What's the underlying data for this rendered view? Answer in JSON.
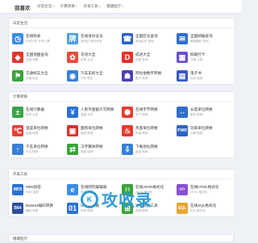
{
  "header": {
    "brand": "我喜欢",
    "nav": [
      {
        "label": "日常生活"
      },
      {
        "label": "计算转换"
      },
      {
        "label": "开发工具"
      },
      {
        "label": "健康医疗"
      }
    ]
  },
  "sections": [
    {
      "title": "日常生活",
      "tools": [
        {
          "name": "在线秒表",
          "desc": "在线计时 计时工具",
          "icon": "stopwatch-icon",
          "glyph": "◷",
          "color": "#3a8ee6"
        },
        {
          "name": "在线身份证号",
          "desc": "身份证 号码查询",
          "icon": "id-icon",
          "glyph": "牌",
          "color": "#4a9fe0"
        },
        {
          "name": "全国区号查询",
          "desc": "电话区号 查询",
          "icon": "phone-icon",
          "glyph": "☎",
          "color": "#2d62c6"
        },
        {
          "name": "全国邮编查询",
          "desc": "邮政编码 查询",
          "icon": "mail-icon",
          "glyph": "✉",
          "color": "#2f6fcc"
        },
        {
          "name": "全国地图查询",
          "desc": "全国 地图",
          "icon": "map-icon",
          "glyph": "◆",
          "color": "#e0382e"
        },
        {
          "name": "花语大全",
          "desc": "花语 大全",
          "icon": "flower-icon",
          "glyph": "✿",
          "color": "#e94b3c"
        },
        {
          "name": "成语大全",
          "desc": "成语 查询",
          "icon": "book-icon",
          "glyph": "D",
          "color": "#e8322c"
        },
        {
          "name": "假期打卡",
          "desc": "日期 计算",
          "icon": "calendar-icon",
          "glyph": "▦",
          "color": "#6c4fd2"
        },
        {
          "name": "交通标志大全",
          "desc": "交通 标志",
          "icon": "signs-icon",
          "glyph": "⚑",
          "color": "#3ca33c"
        },
        {
          "name": "汽车车标大全",
          "desc": "汽车 标志",
          "icon": "car-icon",
          "glyph": "◉",
          "color": "#3a7fd6"
        },
        {
          "name": "阿拉伯数字转换",
          "desc": "数字 转换",
          "icon": "people-icon",
          "glyph": "☗",
          "color": "#4a3fb5"
        },
        {
          "name": "电子书",
          "desc": "在线 阅读",
          "icon": "ebook-icon",
          "glyph": "▤",
          "color": "#3a58c8"
        }
      ]
    },
    {
      "title": "计算转换",
      "tools": [
        {
          "name": "在线计算器",
          "desc": "科学 计算",
          "icon": "calculator-icon",
          "glyph": "±",
          "color": "#3ba34a"
        },
        {
          "name": "人民币金额大写转换",
          "desc": "金额 大写",
          "icon": "currency-icon",
          "glyph": "¥",
          "color": "#2a72d8"
        },
        {
          "name": "在线字节转换",
          "desc": "字节 换算",
          "icon": "cube-icon",
          "glyph": "⬢",
          "color": "#e63b2e"
        },
        {
          "name": "长度单位转换",
          "desc": "单位 换算",
          "icon": "ruler-icon",
          "glyph": "⇔",
          "color": "#2f6fcc"
        },
        {
          "name": "温度单位转换",
          "desc": "温度 换算",
          "icon": "thermometer-icon",
          "glyph": "℃",
          "color": "#e8413a"
        },
        {
          "name": "面积单位转换",
          "desc": "面积 换算",
          "icon": "area-icon",
          "glyph": "▣",
          "color": "#d9302a"
        },
        {
          "name": "热量单位转换",
          "desc": "热量 换算",
          "icon": "fire-icon",
          "glyph": "♨",
          "color": "#e8392c"
        },
        {
          "name": "功率单位转换",
          "desc": "功率 换算",
          "icon": "power-icon",
          "glyph": "PWR",
          "color": "#2d62c6"
        },
        {
          "name": "千瓦单位转换",
          "desc": "千瓦 换算",
          "icon": "thermo-icon",
          "glyph": "↑",
          "color": "#3a7fd6"
        },
        {
          "name": "汉字繁体转换",
          "desc": "简繁 转换",
          "icon": "arrows-icon",
          "glyph": "⇄",
          "color": "#3ca33c"
        },
        {
          "name": "下载地址转换",
          "desc": "链接 转换",
          "icon": "download-icon",
          "glyph": "⇩",
          "color": "#3a7fd6"
        }
      ]
    },
    {
      "title": "开发工具",
      "tools": [
        {
          "name": "MD5加密",
          "desc": "MD5 加密",
          "icon": "md5-icon",
          "glyph": "MD5",
          "color": "#2a72d8"
        },
        {
          "name": "在线网页编辑器",
          "desc": "网页 编辑",
          "icon": "browser-icon",
          "glyph": "e",
          "color": "#3a8ee6"
        },
        {
          "name": "在线JSON格式化",
          "desc": "JSON 格式化",
          "icon": "braces-icon",
          "glyph": "{:}",
          "color": "#3ca33c"
        },
        {
          "name": "在线HTML格式化",
          "desc": "HTML 格式化",
          "icon": "code-icon",
          "glyph": "</>",
          "color": "#8a4fd2"
        },
        {
          "name": "Base64编码转换",
          "desc": "编码 转换",
          "icon": "base64-icon",
          "glyph": "B64",
          "color": "#2d4fa0"
        },
        {
          "name": "Unix时间戳",
          "desc": "时间 转换",
          "icon": "unix-icon",
          "glyph": "01",
          "color": "#2a72d8"
        },
        {
          "name": "进制转换工具",
          "desc": "进制 转换",
          "icon": "hash-icon",
          "glyph": "⊞",
          "color": "#3ca33c"
        },
        {
          "name": "在线SQL格式化",
          "desc": "SQL 格式化",
          "icon": "sql-icon",
          "glyph": "SQL",
          "color": "#e8a530"
        }
      ]
    }
  ],
  "watermark": {
    "logo": "K",
    "text": "攻收录"
  },
  "next_section": {
    "title": "健康医疗"
  }
}
